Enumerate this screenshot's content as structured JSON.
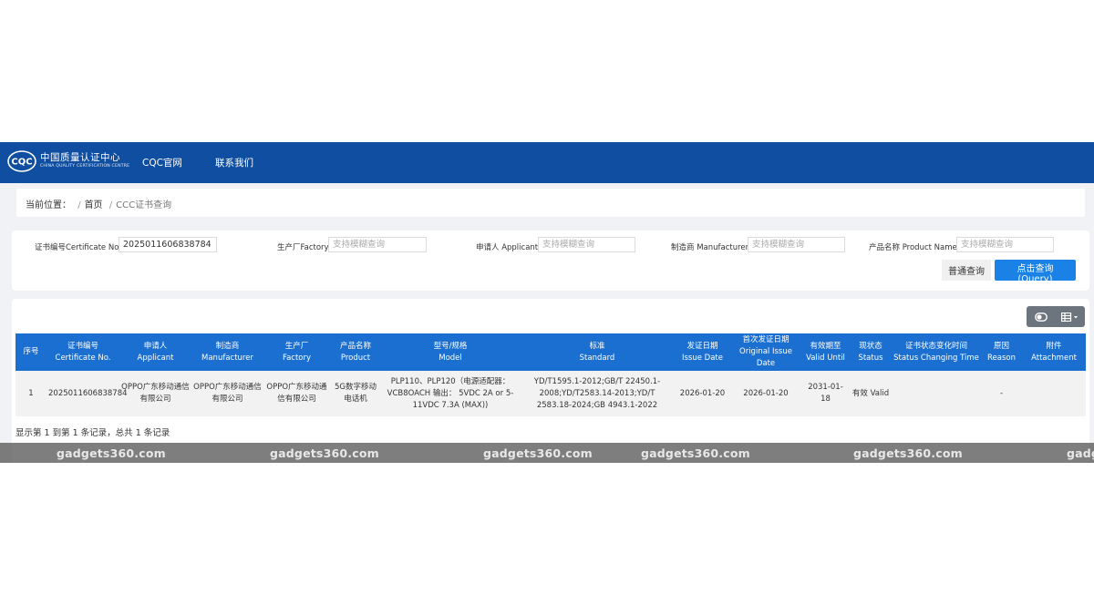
{
  "brand": {
    "logo_letters": "CQC",
    "name_cn": "中国质量认证中心",
    "name_en": "CHINA QUALITY CERTIFICATION CENTRE",
    "color": "#0f4ea0"
  },
  "nav": {
    "items": [
      "CQC官网",
      "联系我们"
    ]
  },
  "breadcrumb": {
    "prefix": "当前位置：",
    "sep": "/",
    "home": "首页",
    "current": "CCC证书查询"
  },
  "search": {
    "fields": [
      {
        "label": "证书编号Certificate No.:",
        "value": "2025011606838784",
        "placeholder": ""
      },
      {
        "label": "生产厂Factory:",
        "value": "",
        "placeholder": "支持模糊查询"
      },
      {
        "label": "申请人 Applicant:",
        "value": "",
        "placeholder": "支持模糊查询"
      },
      {
        "label": "制造商 Manufacturer:",
        "value": "",
        "placeholder": "支持模糊查询"
      },
      {
        "label": "产品名称 Product Name:",
        "value": "",
        "placeholder": "支持模糊查询"
      }
    ],
    "normal_button": "普通查询",
    "query_button": "点击查询(Query)",
    "accent_color": "#1a82e6"
  },
  "toolbar": {
    "icons": [
      "toggle-icon",
      "columns-icon",
      "caret-down-icon"
    ]
  },
  "table": {
    "header_color": "#1a6fd1",
    "columns": [
      {
        "cn": "序号",
        "en": ""
      },
      {
        "cn": "证书编号",
        "en": "Certificate No."
      },
      {
        "cn": "申请人",
        "en": "Applicant"
      },
      {
        "cn": "制造商",
        "en": "Manufacturer"
      },
      {
        "cn": "生产厂",
        "en": "Factory"
      },
      {
        "cn": "产品名称",
        "en": "Product"
      },
      {
        "cn": "型号/规格",
        "en": "Model"
      },
      {
        "cn": "标准",
        "en": "Standard"
      },
      {
        "cn": "发证日期",
        "en": "Issue Date"
      },
      {
        "cn": "首次发证日期",
        "en": "Original Issue Date"
      },
      {
        "cn": "有效期至",
        "en": "Valid Until"
      },
      {
        "cn": "现状态",
        "en": "Status"
      },
      {
        "cn": "证书状态变化时间",
        "en": "Status Changing Time"
      },
      {
        "cn": "原因",
        "en": "Reason"
      },
      {
        "cn": "附件",
        "en": "Attachment"
      }
    ],
    "rows": [
      [
        "1",
        "2025011606838784",
        "OPPO广东移动通信有限公司",
        "OPPO广东移动通信有限公司",
        "OPPO广东移动通信有限公司",
        "5G数字移动电话机",
        "PLP110、PLP120（电源适配器：VCB8OACH 输出： 5VDC 2A or 5-11VDC 7.3A (MAX))",
        "YD/T1595.1-2012;GB/T 22450.1-2008;YD/T2583.14-2013;YD/T 2583.18-2024;GB 4943.1-2022",
        "2026-01-20",
        "2026-01-20",
        "2031-01-18",
        "有效 Valid",
        "",
        "-",
        ""
      ]
    ]
  },
  "summary": "显示第 1 到第 1 条记录，总共 1 条记录",
  "watermark": {
    "text": "gadgets360.com"
  }
}
